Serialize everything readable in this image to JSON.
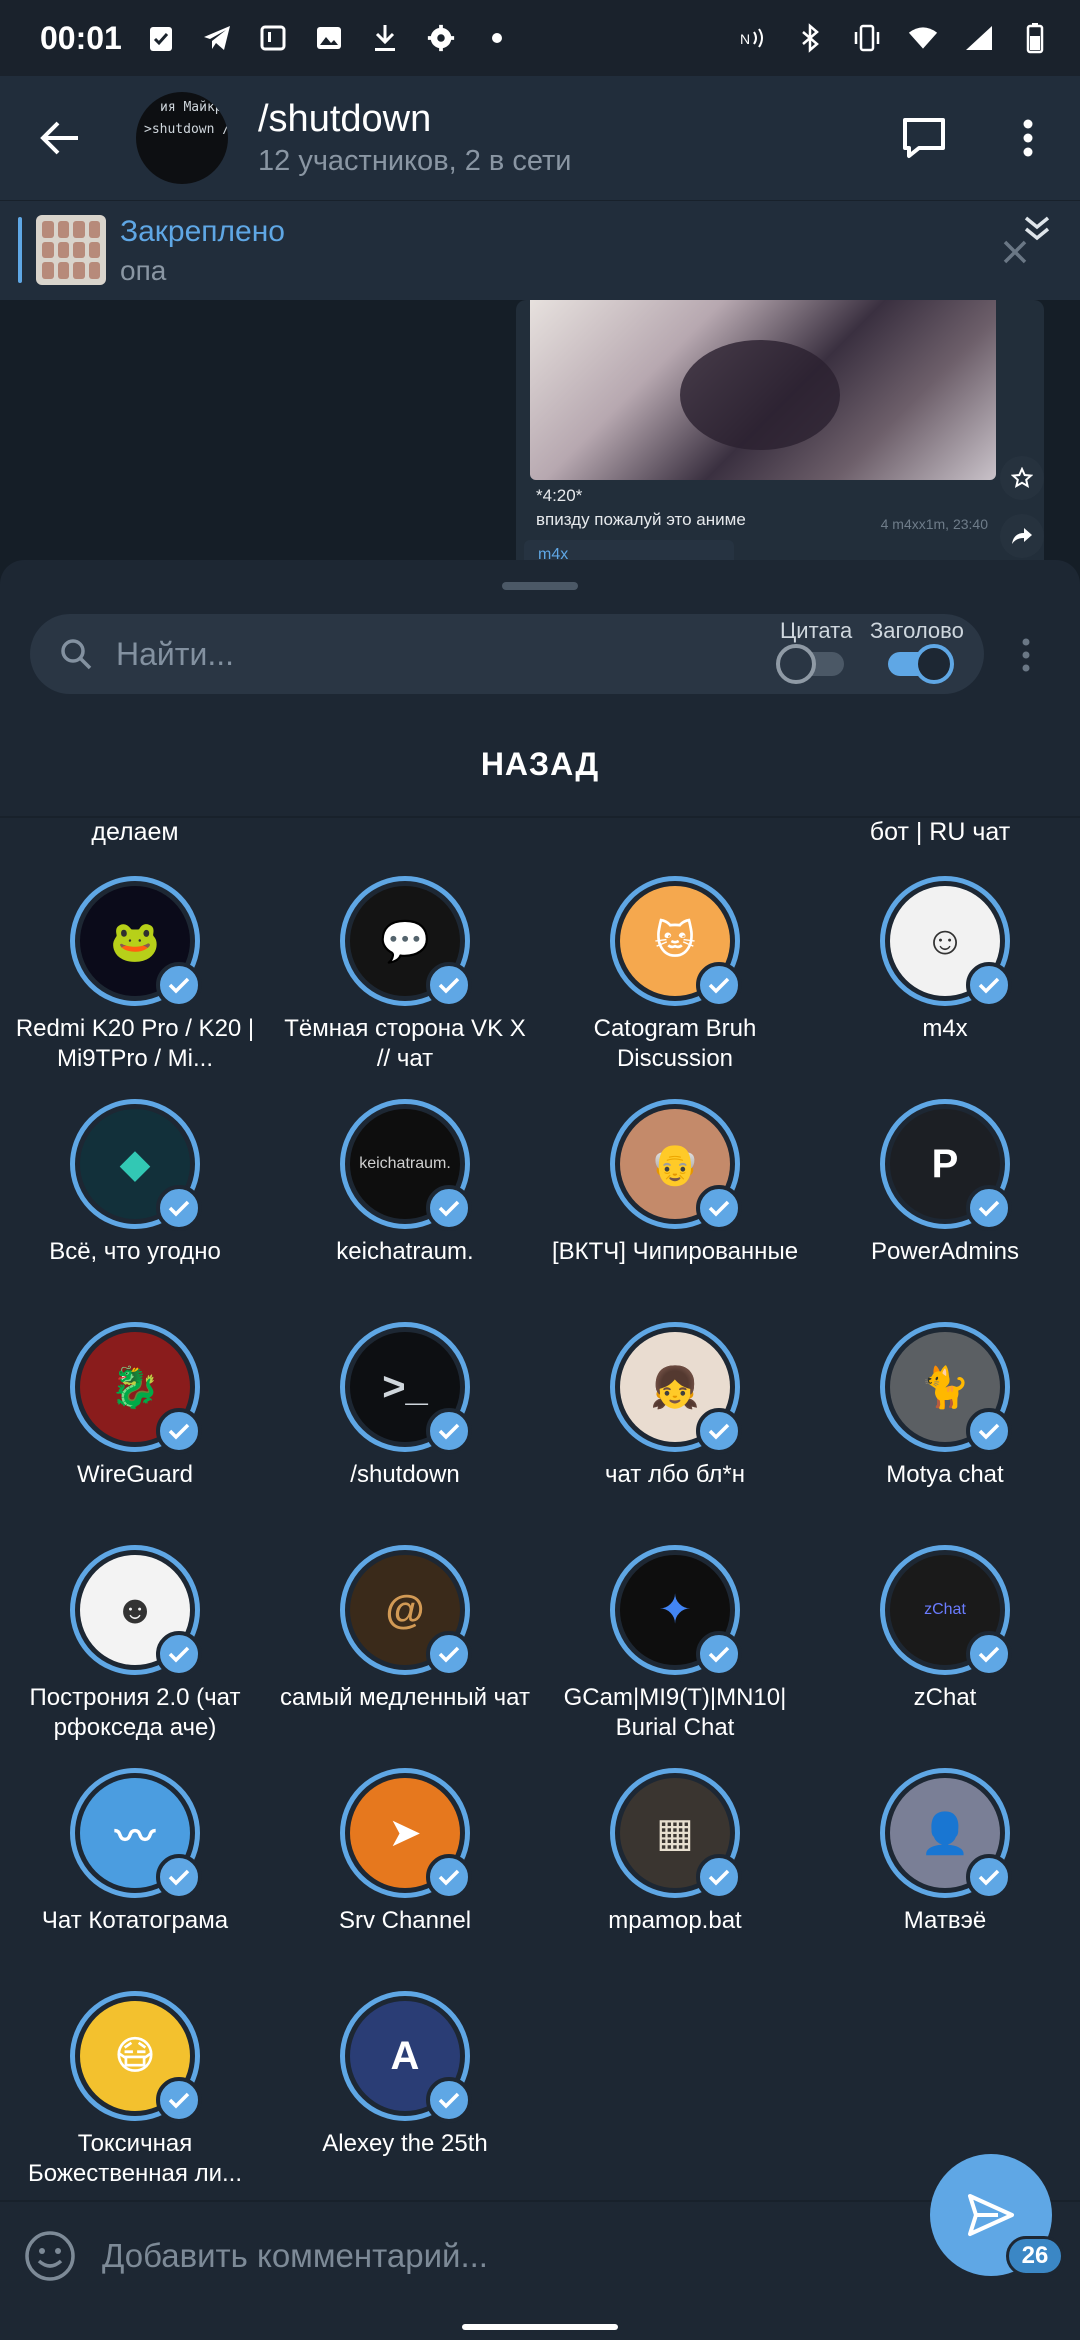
{
  "status_bar": {
    "time": "00:01",
    "icons_left": [
      "clipboard-check-icon",
      "telegram-icon",
      "square-icon",
      "image-icon",
      "download-icon",
      "settings-cog-icon",
      "dot-icon"
    ],
    "icons_right": [
      "nfc-icon",
      "bluetooth-icon",
      "vibrate-icon",
      "wifi-icon",
      "signal-icon",
      "battery-icon"
    ]
  },
  "header": {
    "title": "/shutdown",
    "subtitle": "12 участников, 2 в сети",
    "avatar_lines": [
      "ия Майкро",
      ">shutdown /s"
    ]
  },
  "pinned": {
    "title": "Закреплено",
    "text": "опа"
  },
  "message": {
    "caption": "*4:20*",
    "text": "впизду пожалуй это аниме",
    "meta": "4  m4xx1m, 23:40",
    "next_author": "m4x"
  },
  "sheet": {
    "search_placeholder": "Найти...",
    "toggle_quote_label": "Цитата",
    "toggle_quote_on": false,
    "toggle_header_label": "Заголово",
    "toggle_header_on": true,
    "back_label": "НАЗАД",
    "partial_left": "делаем",
    "partial_right": "бот | RU чат"
  },
  "chats": [
    {
      "name": "Redmi K20 Pro / K20 | Mi9TPro / Mi...",
      "icon": "redmi-frog-icon",
      "bg": "#0b0b1a",
      "fg": "#4a5cff",
      "mark": "🐸"
    },
    {
      "name": "Тёмная сторона VK X // чат",
      "icon": "chat-bubbles-icon",
      "bg": "#141414",
      "fg": "#3fbf6a",
      "mark": "💬"
    },
    {
      "name": "Catogram Bruh Discussion",
      "icon": "cat-icon",
      "bg": "#f5a84e",
      "fg": "#ffffff",
      "mark": "🐱"
    },
    {
      "name": "m4x",
      "icon": "meme-face-icon",
      "bg": "#f2f2f2",
      "fg": "#333333",
      "mark": "☺"
    },
    {
      "name": "Всё, что угодно",
      "icon": "cube-icon",
      "bg": "#12303a",
      "fg": "#32c8b4",
      "mark": "◆"
    },
    {
      "name": "keichatraum.",
      "icon": "text-logo-icon",
      "bg": "#0e0e0e",
      "fg": "#d0d0d0",
      "mark": "keichatraum."
    },
    {
      "name": "[ВКТЧ] Чипированные",
      "icon": "person-photo-icon",
      "bg": "#c48a6a",
      "fg": "#ffffff",
      "mark": "👴"
    },
    {
      "name": "PowerAdmins",
      "icon": "letter-p-icon",
      "bg": "#1c1f24",
      "fg": "#ffffff",
      "mark": "P"
    },
    {
      "name": "WireGuard",
      "icon": "wireguard-dragon-icon",
      "bg": "#8a1c1c",
      "fg": "#ffffff",
      "mark": "🐉"
    },
    {
      "name": "/shutdown",
      "icon": "terminal-icon",
      "bg": "#0d0f12",
      "fg": "#cfd6dc",
      "mark": ">_"
    },
    {
      "name": "чат лбо бл*н",
      "icon": "anime-girl-icon",
      "bg": "#e9dcd0",
      "fg": "#6b3b22",
      "mark": "👧"
    },
    {
      "name": "Motya chat",
      "icon": "cat-photo-icon",
      "bg": "#5b5f63",
      "fg": "#ffffff",
      "mark": "🐈"
    },
    {
      "name": "Построния 2.0 (чат рфокседа аче)",
      "icon": "troll-face-icon",
      "bg": "#f3f3f3",
      "fg": "#333333",
      "mark": "☻"
    },
    {
      "name": "самый медленный чат",
      "icon": "spiral-icon",
      "bg": "#3a2a1a",
      "fg": "#d29a55",
      "mark": "@"
    },
    {
      "name": "GCam|MI9(T)|MN10| Burial Chat",
      "icon": "pinwheel-icon",
      "bg": "#0e0e0e",
      "fg": "#4285f4",
      "mark": "✦"
    },
    {
      "name": "zChat",
      "icon": "zchat-logo-icon",
      "bg": "#1a1a1a",
      "fg": "#6a7cff",
      "mark": "zChat"
    },
    {
      "name": "Чат Котатограма",
      "icon": "mustache-icon",
      "bg": "#4b9de0",
      "fg": "#ffffff",
      "mark": "〰"
    },
    {
      "name": "Srv Channel",
      "icon": "srv-plane-icon",
      "bg": "#e6781e",
      "fg": "#ffffff",
      "mark": "➤"
    },
    {
      "name": "mpamop.bat",
      "icon": "chalkboard-icon",
      "bg": "#3a3530",
      "fg": "#e8e0d0",
      "mark": "▦"
    },
    {
      "name": "Матвэё",
      "icon": "anime-face-icon",
      "bg": "#7a7f96",
      "fg": "#ffffff",
      "mark": "👤"
    },
    {
      "name": "Токсичная Божественная ли...",
      "icon": "anime-masked-icon",
      "bg": "#f3c12e",
      "fg": "#ffffff",
      "mark": "😷"
    },
    {
      "name": "Alexey the 25th",
      "icon": "letter-a-icon",
      "bg": "#2a3d75",
      "fg": "#ffffff",
      "mark": "A"
    }
  ],
  "comment": {
    "placeholder": "Добавить комментарий..."
  },
  "send": {
    "count": "26"
  },
  "colors": {
    "accent": "#5fa7e5",
    "sheet_bg": "#1d2733",
    "header_bg": "#212d3b"
  }
}
